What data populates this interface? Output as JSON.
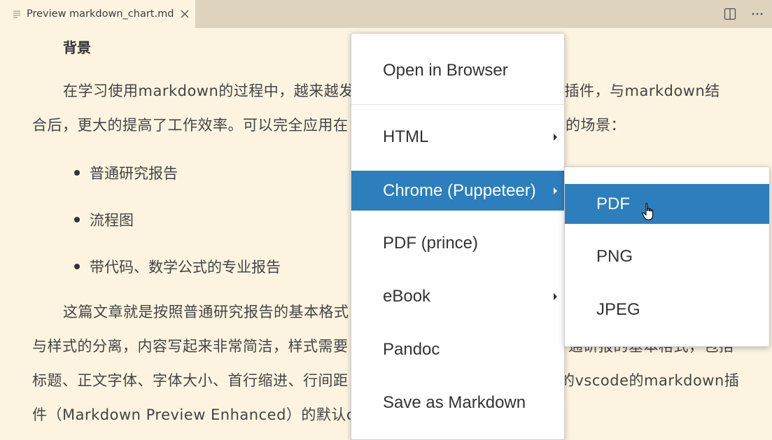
{
  "tab": {
    "title": "Preview markdown_chart.md",
    "icon": "preview-lines-icon",
    "close_icon": "close-icon"
  },
  "actions": {
    "split": "split-editor-icon",
    "more": "more-actions-icon"
  },
  "document": {
    "heading": "背景",
    "para1_line1": "在学习使用markdown的过程中，越来越发",
    "para1_line1_right": "的插件，与markdown结",
    "para1_line2": "合后，更大的提高了工作效率。可以完全应用在",
    "para1_line2_right": "的场景：",
    "bullets": [
      "普通研究报告",
      "流程图",
      "带代码、数学公式的专业报告"
    ],
    "para2_line1": "这篇文章就是按照普通研究报告的基本格式",
    "para2_line2": "与样式的分离，内容写起来非常简洁，样式需要",
    "para2_line2_right": "通研报的基本格式，包括",
    "para2_line3": "标题、正文字体、字体大小、首行缩进、行间距",
    "para2_line3_right": "的vscode的markdown插",
    "para2_line4": "件（Markdown Preview Enhanced）的默认cs"
  },
  "menu": {
    "items": [
      {
        "label": "Open in Browser",
        "submenu": false
      },
      {
        "label": "HTML",
        "submenu": true
      },
      {
        "label": "Chrome (Puppeteer)",
        "submenu": true,
        "active": true
      },
      {
        "label": "PDF (prince)",
        "submenu": false
      },
      {
        "label": "eBook",
        "submenu": true
      },
      {
        "label": "Pandoc",
        "submenu": false
      },
      {
        "label": "Save as Markdown",
        "submenu": false
      }
    ]
  },
  "submenu": {
    "items": [
      {
        "label": "PDF",
        "active": true
      },
      {
        "label": "PNG"
      },
      {
        "label": "JPEG"
      }
    ]
  },
  "colors": {
    "highlight": "#2c7ebd",
    "background": "#fcf4e0",
    "tabbar": "#ddd3bf"
  }
}
